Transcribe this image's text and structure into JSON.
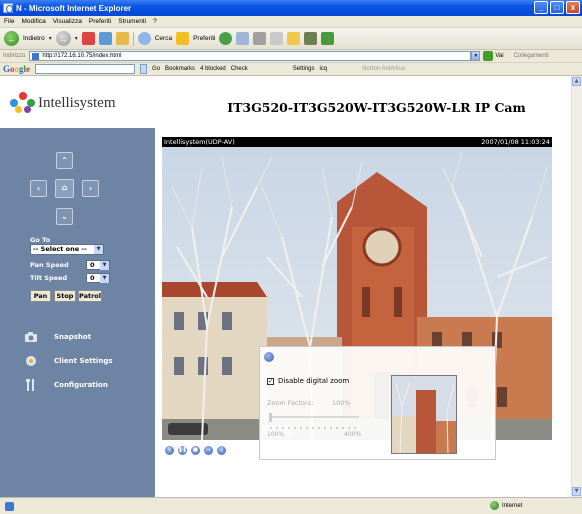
{
  "window": {
    "title": "N - Microsoft Internet Explorer",
    "buttons": [
      "_",
      "□",
      "x"
    ]
  },
  "menubar": [
    "File",
    "Modifica",
    "Visualizza",
    "Preferiti",
    "Strumenti",
    "?"
  ],
  "toolbar": {
    "back": "Indietro",
    "search": "Cerca",
    "favorites": "Preferiti"
  },
  "address": {
    "label": "Indirizzo",
    "url": "http://172.16.10.75/index.html",
    "go": "Vai",
    "links": "Collegamenti"
  },
  "google_bar": {
    "go": "Go",
    "bookmarks": "Bookmarks",
    "blocked": "4 blocked",
    "check": "Check",
    "settings": "Settings",
    "icq": "icq",
    "antivirus": "Norton AntiVirus"
  },
  "header": {
    "brand": "Intellisystem",
    "camera_title": "IT3G520-IT3G520W-IT3G520W-LR IP Cam"
  },
  "sidebar": {
    "goto_label": "Go To",
    "goto_value": "-- Select one --",
    "pan_speed_label": "Pan Speed",
    "pan_speed_value": "0",
    "tilt_speed_label": "Tilt Speed",
    "tilt_speed_value": "0",
    "buttons": [
      "Pan",
      "Stop",
      "Patrol"
    ],
    "nav": [
      {
        "label": "Snapshot",
        "icon": "camera-icon"
      },
      {
        "label": "Client Settings",
        "icon": "client-settings-icon"
      },
      {
        "label": "Configuration",
        "icon": "tools-icon"
      }
    ]
  },
  "video": {
    "source": "Intellisystem(UDP-AV)",
    "timestamp": "2007/01/08 11:03:24"
  },
  "zoom_panel": {
    "checkbox_label": "Disable digital zoom",
    "checked": true,
    "factor_label": "Zoom Factors:",
    "factor_value": "100%",
    "min": "100%",
    "max": "400%"
  },
  "status": {
    "zone": "Internet"
  }
}
